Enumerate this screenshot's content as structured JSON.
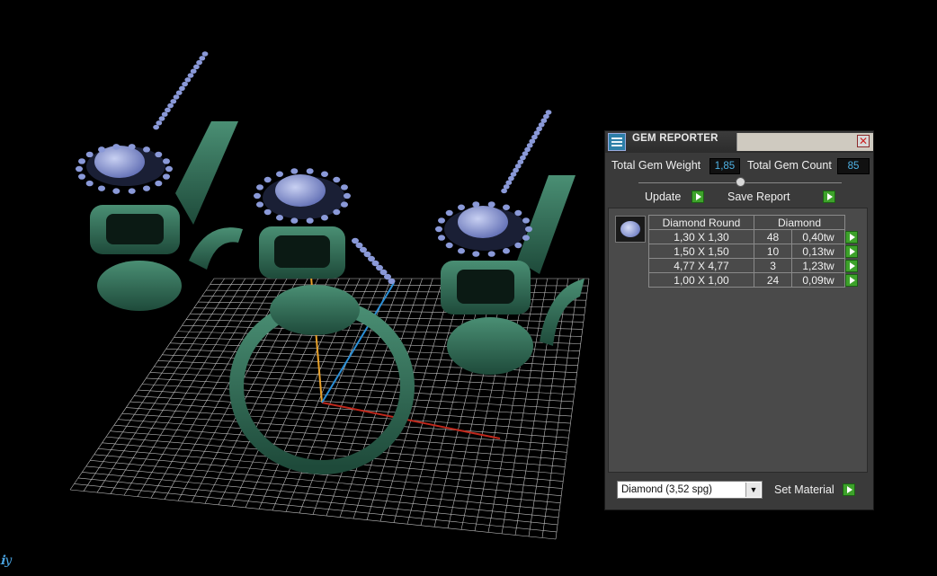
{
  "panel": {
    "title": "GEM REPORTER",
    "close_glyph": "✕",
    "total_weight_label": "Total Gem Weight",
    "total_weight_value": "1,85",
    "total_count_label": "Total Gem Count",
    "total_count_value": "85",
    "update_label": "Update",
    "save_label": "Save Report",
    "table": {
      "headers": [
        "Diamond Round",
        "Diamond"
      ],
      "rows": [
        {
          "size": "1,30 X 1,30",
          "count": "48",
          "weight": "0,40tw"
        },
        {
          "size": "1,50 X 1,50",
          "count": "10",
          "weight": "0,13tw"
        },
        {
          "size": "4,77 X 4,77",
          "count": "3",
          "weight": "1,23tw"
        },
        {
          "size": "1,00 X 1,00",
          "count": "24",
          "weight": "0,09tw"
        }
      ]
    },
    "material_value": "Diamond     (3,52 spg)",
    "set_material_label": "Set Material"
  },
  "viewport": {
    "axis_glyph": "ℹy"
  },
  "colors": {
    "metal": "#2f6b55",
    "gem": "#8a99d8",
    "grid": "#cfcfcf",
    "x_axis": "#c0281c",
    "y_axis": "#e8a12a",
    "z_axis": "#2b8fd6",
    "accent_go": "#3da22a"
  },
  "icons": [
    "app-icon",
    "close-icon",
    "play-arrow-icon",
    "dropdown-arrow-icon",
    "gem-thumbnail-icon"
  ]
}
